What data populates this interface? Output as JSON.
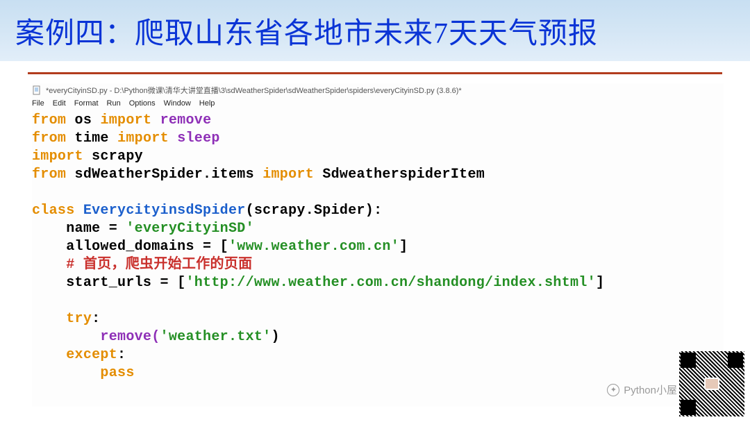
{
  "slide": {
    "title": "案例四：爬取山东省各地市未来7天天气预报"
  },
  "editor": {
    "window_title": "*everyCityinSD.py - D:\\Python微课\\清华大讲堂直播\\3\\sdWeatherSpider\\sdWeatherSpider\\spiders\\everyCityinSD.py (3.8.6)*",
    "menu": [
      "File",
      "Edit",
      "Format",
      "Run",
      "Options",
      "Window",
      "Help"
    ]
  },
  "code": {
    "l1": {
      "kw1": "from",
      "mod1": "os",
      "kw2": "import",
      "name": "remove"
    },
    "l2": {
      "kw1": "from",
      "mod1": "time",
      "kw2": "import",
      "name": "sleep"
    },
    "l3": {
      "kw1": "import",
      "mod1": "scrapy"
    },
    "l4": {
      "kw1": "from",
      "mod1": "sdWeatherSpider.items",
      "kw2": "import",
      "name": "SdweatherspiderItem"
    },
    "l6": {
      "kw1": "class",
      "cls": "EverycityinsdSpider",
      "args": "(scrapy.Spider):"
    },
    "l7": {
      "var": "name = ",
      "str": "'everyCityinSD'"
    },
    "l8": {
      "var": "allowed_domains = [",
      "str": "'www.weather.com.cn'",
      "close": "]"
    },
    "l9": {
      "cmt": "# 首页，爬虫开始工作的页面"
    },
    "l10": {
      "var": "start_urls = [",
      "str": "'http://www.weather.com.cn/shandong/index.shtml'",
      "close": "]"
    },
    "l12": {
      "kw": "try",
      "colon": ":"
    },
    "l13": {
      "fn": "remove(",
      "str": "'weather.txt'",
      "close": ")"
    },
    "l14": {
      "kw": "except",
      "colon": ":"
    },
    "l15": {
      "kw": "pass"
    }
  },
  "watermark": {
    "text": "Python小屋"
  }
}
